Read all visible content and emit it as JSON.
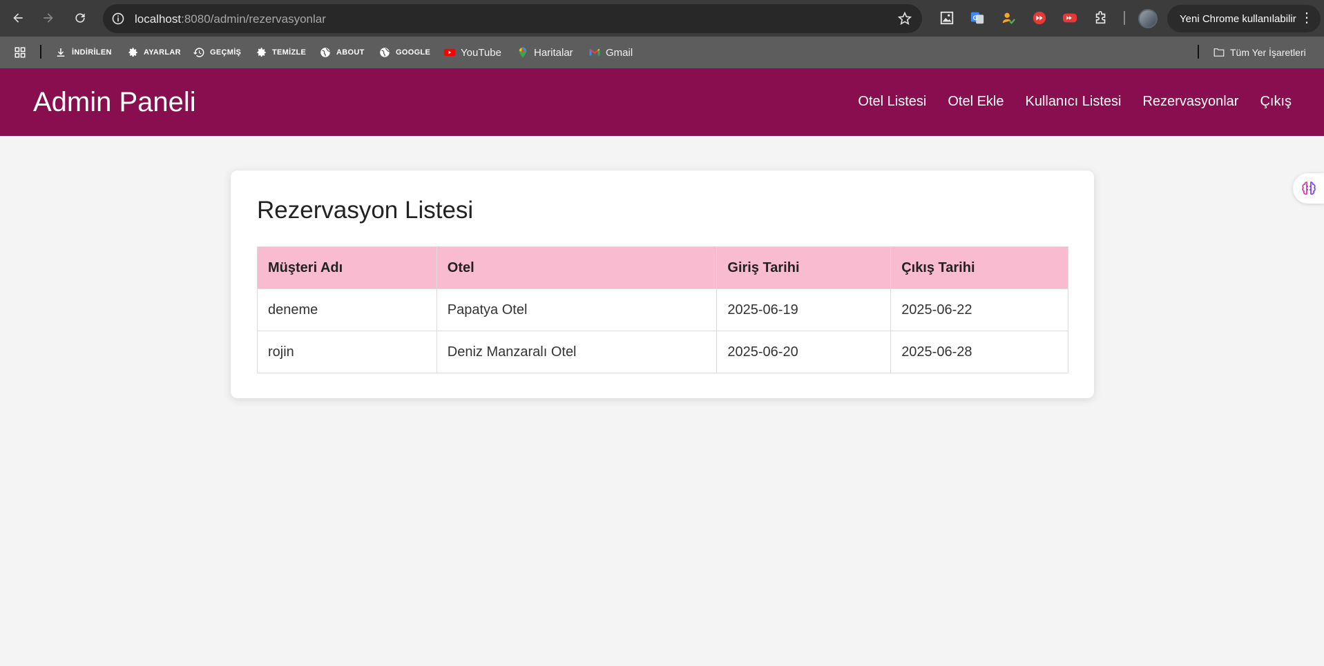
{
  "browser": {
    "url_host": "localhost",
    "url_path": ":8080/admin/rezervasyonlar",
    "update_button": "Yeni Chrome kullanılabilir",
    "bookmarks": [
      {
        "label": "İNDİRİLEN",
        "icon": "download-icon"
      },
      {
        "label": "AYARLAR",
        "icon": "gear-icon"
      },
      {
        "label": "GEÇMİŞ",
        "icon": "history-icon"
      },
      {
        "label": "TEMİZLE",
        "icon": "gear-icon"
      },
      {
        "label": "ABOUT",
        "icon": "globe-icon"
      },
      {
        "label": "GOOGLE",
        "icon": "globe-icon"
      },
      {
        "label": "YouTube",
        "icon": "youtube-icon"
      },
      {
        "label": "Haritalar",
        "icon": "maps-icon"
      },
      {
        "label": "Gmail",
        "icon": "gmail-icon"
      }
    ],
    "all_bookmarks": "Tüm Yer İşaretleri"
  },
  "header": {
    "brand": "Admin Paneli",
    "nav": [
      "Otel Listesi",
      "Otel Ekle",
      "Kullanıcı Listesi",
      "Rezervasyonlar",
      "Çıkış"
    ]
  },
  "main": {
    "title": "Rezervasyon Listesi",
    "columns": [
      "Müşteri Adı",
      "Otel",
      "Giriş Tarihi",
      "Çıkış Tarihi"
    ],
    "rows": [
      [
        "deneme",
        "Papatya Otel",
        "2025-06-19",
        "2025-06-22"
      ],
      [
        "rojin",
        "Deniz Manzaralı Otel",
        "2025-06-20",
        "2025-06-28"
      ]
    ]
  },
  "colors": {
    "header_bg": "#880e4f",
    "table_header_bg": "#f8bbd0",
    "page_bg": "#f4f4f4"
  }
}
